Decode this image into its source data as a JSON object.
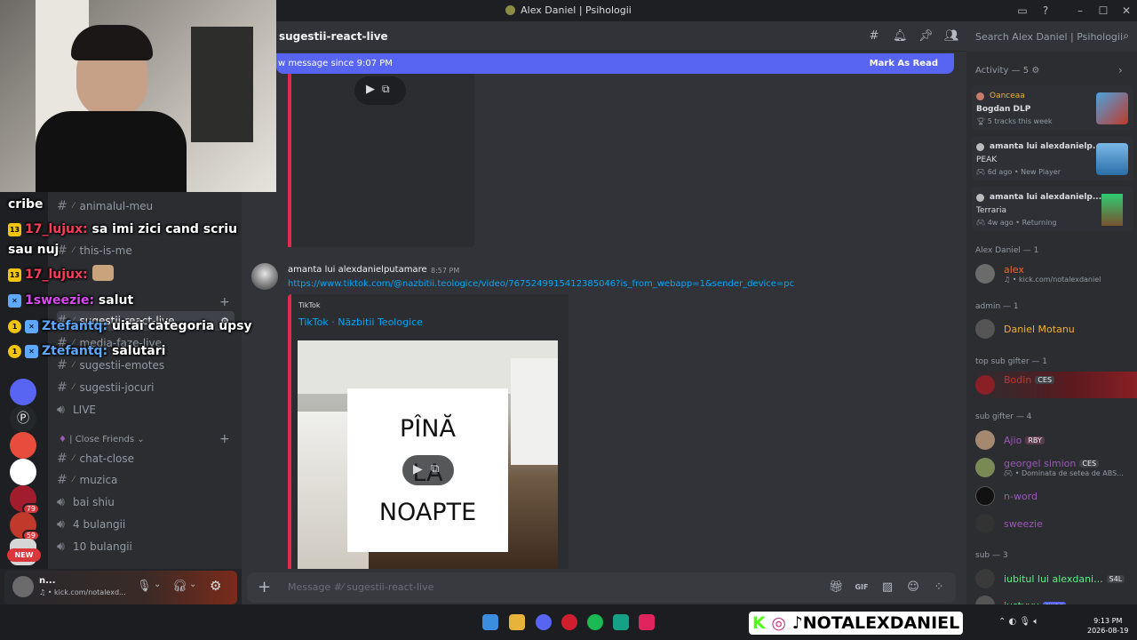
{
  "window": {
    "title": "Alex Daniel | Psihologii"
  },
  "header": {
    "channel": "sugestii-react-live",
    "search_placeholder": "Search Alex Daniel | Psihologii"
  },
  "new_bar": {
    "text": "w message since 9:07 PM",
    "action": "Mark As Read"
  },
  "overlay_chat": [
    {
      "text": "cribe"
    },
    {
      "badge": "13",
      "nick": "17_lujux:",
      "msg": "sa imi zici cand scriu"
    },
    {
      "text": "sau nuj"
    },
    {
      "badge": "13",
      "nick": "17_lujux:",
      "msg": ""
    },
    {
      "nick": "1sweezie:",
      "msg": "salut"
    },
    {
      "badge": "1",
      "nick": "Ztefantq:",
      "msg": "uitai categoria upsy"
    },
    {
      "badge": "1",
      "nick": "Ztefantq:",
      "msg": "salutari"
    }
  ],
  "sidebar": {
    "channels": [
      {
        "name": "animalul-meu",
        "kind": "text"
      },
      {
        "name": "this-is-me",
        "kind": "text"
      },
      {
        "name": "sugestii-react-live",
        "kind": "text",
        "selected": true
      },
      {
        "name": "media-faze-live",
        "kind": "text"
      },
      {
        "name": "sugestii-emotes",
        "kind": "text"
      },
      {
        "name": "sugestii-jocuri",
        "kind": "text"
      },
      {
        "name": "LIVE",
        "kind": "voice"
      }
    ],
    "category": "Close Friends",
    "category_channels": [
      {
        "name": "chat-close",
        "kind": "text"
      },
      {
        "name": "muzica",
        "kind": "text"
      },
      {
        "name": "bai shiu",
        "kind": "voice"
      },
      {
        "name": "4 bulangii",
        "kind": "voice"
      },
      {
        "name": "10 bulangii",
        "kind": "voice"
      }
    ]
  },
  "servers": {
    "badges": [
      "79",
      "59"
    ],
    "new_label": "NEW"
  },
  "user_panel": {
    "name": "n...",
    "status": "kick.com/notalexd..."
  },
  "message": {
    "author": "amanta lui alexdanielputamare",
    "time": "8:57 PM",
    "link": "https://www.tiktok.com/@nazbitii.teologice/video/7675249915412385046?is_from_webapp=1&sender_device=pc",
    "embed_provider": "TikTok",
    "embed_title": "TikTok · Năzbitii Teologice",
    "thumb_lines": [
      "PÎNĂ",
      "LA",
      "NOAPTE"
    ]
  },
  "composer": {
    "placeholder": "Message #⁄ sugestii-react-live"
  },
  "members": {
    "activity_header": "Activity — 5",
    "activities": [
      {
        "user": "Oanceaa",
        "title": "Bogdan DLP",
        "sub": "5 tracks this week"
      },
      {
        "user": "amanta lui alexdanielp...",
        "title": "PEAK",
        "sub": "6d ago",
        "sub2": "New Player"
      },
      {
        "user": "amanta lui alexdanielp...",
        "title": "Terraria",
        "sub": "4w ago",
        "sub2": "Returning"
      }
    ],
    "groups": [
      {
        "label": "Alex Daniel — 1",
        "members": [
          {
            "name": "alex",
            "color": "#f26522",
            "status": "kick.com/notalexdaniel"
          }
        ]
      },
      {
        "label": "admin — 1",
        "members": [
          {
            "name": "Daniel Motanu",
            "color": "#f0b232"
          }
        ]
      },
      {
        "label": "top sub gifter — 1",
        "members": [
          {
            "name": "Bodin",
            "color": "#c0392b",
            "tag": "CES"
          }
        ]
      },
      {
        "label": "sub gifter — 4",
        "members": [
          {
            "name": "Ajio",
            "color": "#9b59b6",
            "tag": "RBY"
          },
          {
            "name": "georgel simion",
            "color": "#9b59b6",
            "tag": "CES",
            "status": "Dominata de setea de ABS..."
          },
          {
            "name": "n-word",
            "color": "#9b59b6"
          },
          {
            "name": "sweezie",
            "color": "#9b59b6"
          }
        ]
      },
      {
        "label": "sub — 3",
        "members": [
          {
            "name": "iubitul lui alexdani...",
            "color": "#57f287",
            "tag": "S4L"
          },
          {
            "name": "iustyyy",
            "color": "#57f287",
            "tag": "swag"
          }
        ]
      }
    ]
  },
  "taskbar": {
    "brand": "NOTALEXDANIEL",
    "time": "9:13 PM",
    "date": "2026-08-19"
  }
}
